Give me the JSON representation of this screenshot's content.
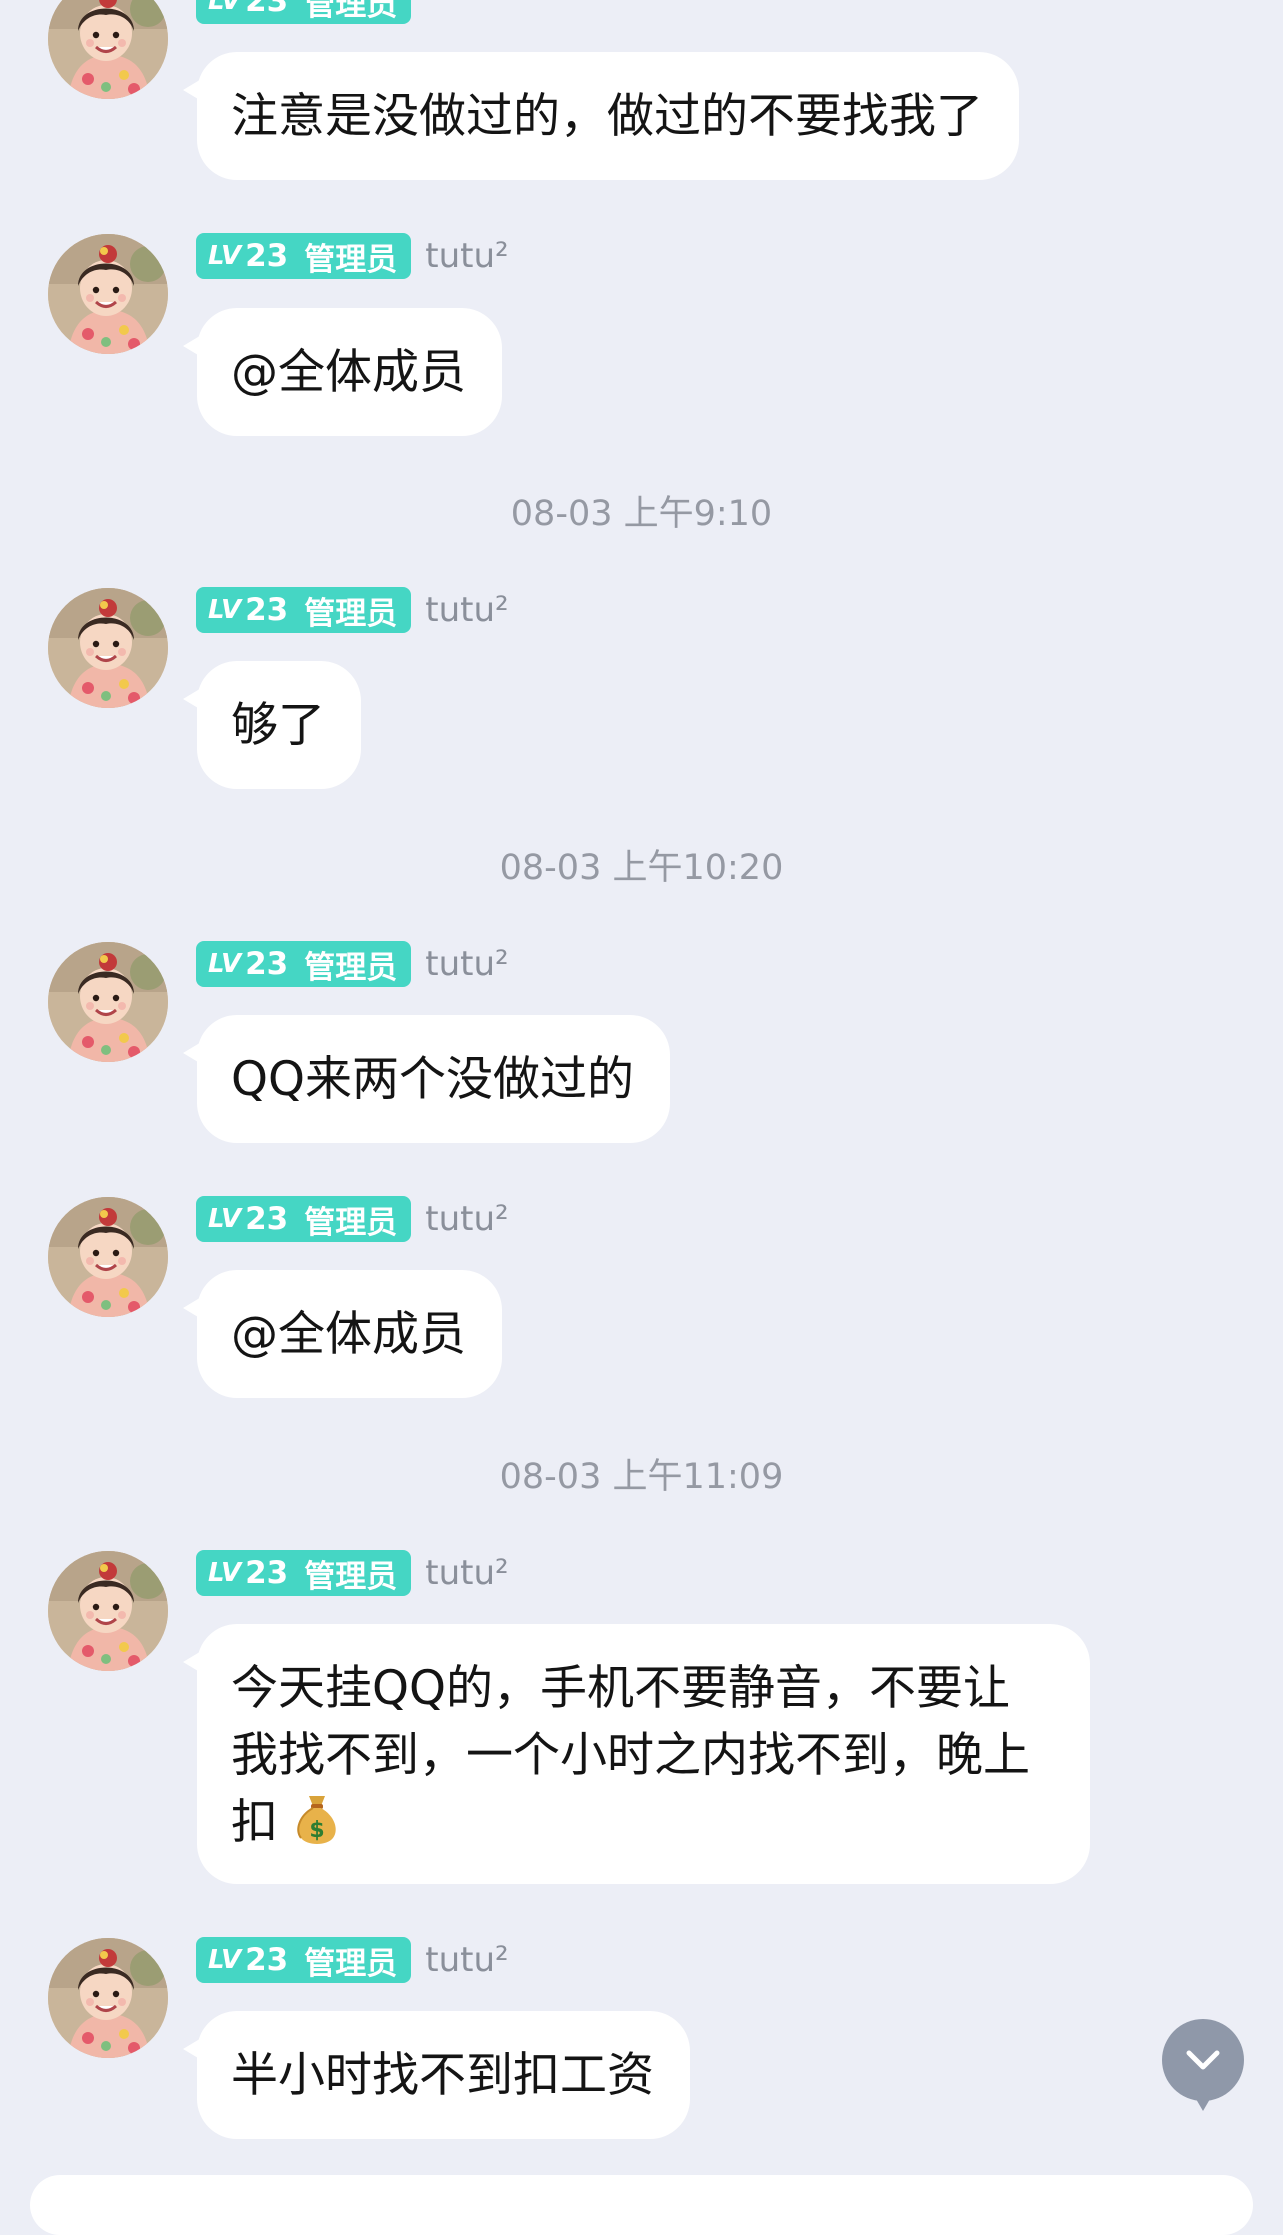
{
  "sender": {
    "level_prefix": "LV",
    "level": "23",
    "role": "管理员",
    "name": "tutu²",
    "avatar_icon": "avatar-girl-photo"
  },
  "messages": [
    {
      "text": "注意是没做过的，做过的不要找我了"
    },
    {
      "text": "@全体成员"
    },
    {
      "text": "够了"
    },
    {
      "text": "QQ来两个没做过的"
    },
    {
      "text": "@全体成员"
    },
    {
      "text": "今天挂QQ的，手机不要静音，不要让我找不到，一个小时之内找不到，晚上扣",
      "emoji": "money-bag-icon"
    },
    {
      "text": "半小时找不到扣工资"
    }
  ],
  "timestamps": [
    "08-03 上午9:10",
    "08-03 上午10:20",
    "08-03 上午11:09"
  ],
  "controls": {
    "scroll_down_icon": "chevron-down-icon"
  },
  "colors": {
    "background": "#eceef6",
    "bubble": "#ffffff",
    "badge": "#45d6c4",
    "timestamp_text": "#9599a3",
    "sender_text": "#8a8f9a",
    "scroll_button": "#8f98a9"
  }
}
